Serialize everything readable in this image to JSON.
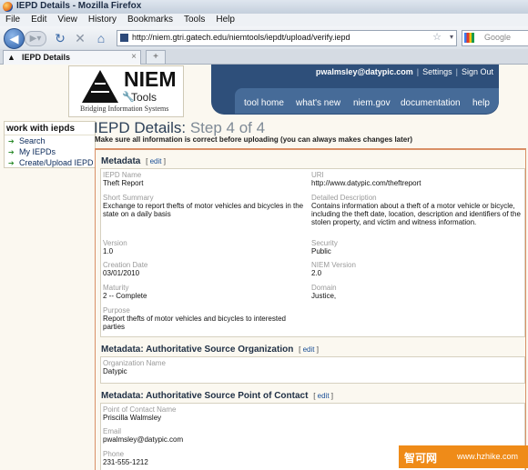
{
  "window": {
    "title": "IEPD Details - Mozilla Firefox"
  },
  "menu": [
    "File",
    "Edit",
    "View",
    "History",
    "Bookmarks",
    "Tools",
    "Help"
  ],
  "nav": {
    "url": "http://niem.gtri.gatech.edu/niemtools/iepdt/upload/verify.iepd",
    "search_placeholder": "Google"
  },
  "tab": {
    "label": "IEPD Details"
  },
  "logo": {
    "name": "NIEM",
    "tools": "Tools",
    "tagline": "Bridging Information Systems"
  },
  "header": {
    "email": "pwalmsley@datypic.com",
    "settings": "Settings",
    "sign_out": "Sign Out",
    "links": [
      "tool home",
      "what's new",
      "niem.gov",
      "documentation",
      "help"
    ]
  },
  "sidebar": {
    "heading": "work with iepds",
    "items": [
      "Search",
      "My IEPDs",
      "Create/Upload IEPD"
    ]
  },
  "page": {
    "title": "IEPD Details:",
    "step": "Step 4 of 4",
    "subtitle": "Make sure all information is correct before uploading (you can always makes changes later)"
  },
  "metadata": {
    "title": "Metadata",
    "edit": "edit",
    "fields": {
      "iepd_name": {
        "label": "IEPD Name",
        "value": "Theft Report"
      },
      "uri": {
        "label": "URI",
        "value": "http://www.datypic.com/theftreport"
      },
      "short_summary": {
        "label": "Short Summary",
        "value": "Exchange to report thefts of motor vehicles and bicycles in the state on a daily basis"
      },
      "detailed_description": {
        "label": "Detailed Description",
        "value": "Contains information about a theft of a motor vehicle or bicycle, including the theft date, location, description and identifiers of the stolen property, and victim and witness information."
      },
      "version": {
        "label": "Version",
        "value": "1.0"
      },
      "security": {
        "label": "Security",
        "value": "Public"
      },
      "creation_date": {
        "label": "Creation Date",
        "value": "03/01/2010"
      },
      "niem_version": {
        "label": "NIEM Version",
        "value": "2.0"
      },
      "maturity": {
        "label": "Maturity",
        "value": "2 -- Complete"
      },
      "domain": {
        "label": "Domain",
        "value": "Justice,"
      },
      "purpose": {
        "label": "Purpose",
        "value": "Report thefts of motor vehicles and bicycles to interested parties"
      }
    }
  },
  "auth_org": {
    "title": "Metadata: Authoritative Source Organization",
    "edit": "edit",
    "org_label": "Organization Name",
    "org_value": "Datypic"
  },
  "poc": {
    "title": "Metadata: Authoritative Source Point of Contact",
    "edit": "edit",
    "name_label": "Point of Contact Name",
    "name_value": "Priscilla Walmsley",
    "email_label": "Email",
    "email_value": "pwalmsley@datypic.com",
    "phone_label": "Phone",
    "phone_value": "231-555-1212"
  },
  "watermark": {
    "cn": "智可网",
    "url": "www.hzhike.com"
  }
}
